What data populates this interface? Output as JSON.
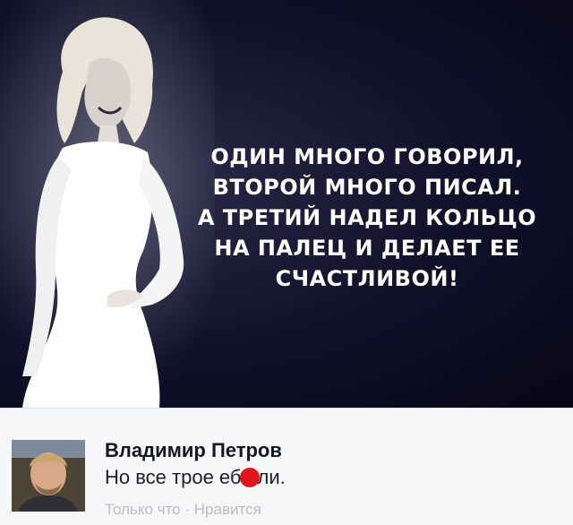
{
  "post": {
    "quote_lines": [
      "ОДИН МНОГО ГОВОРИЛ,",
      "ВТОРОЙ МНОГО ПИСАЛ.",
      "А ТРЕТИЙ НАДЕЛ КОЛЬЦО",
      "НА ПАЛЕЦ И ДЕЛАЕТ ЕЕ",
      "СЧАСТЛИВОЙ!"
    ]
  },
  "comment": {
    "author": "Владимир Петров",
    "text_before": "Но все трое еб",
    "text_after": "ли.",
    "time": "Только что",
    "separator": "·",
    "like_label": "Нравится"
  },
  "colors": {
    "image_background": "#0b0b20",
    "redaction": "#e4141c"
  }
}
